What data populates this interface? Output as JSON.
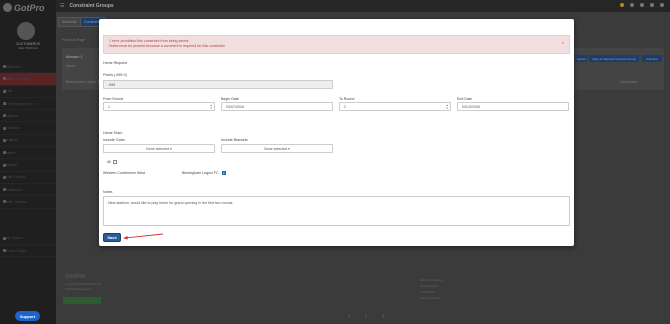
{
  "app": {
    "logo": "GotPro",
    "top_title": "Constraint Groups"
  },
  "user": {
    "name": "CUSTOMERUS",
    "link": "SEE PROFILE"
  },
  "sidebar": {
    "items": [
      {
        "label": "Dashboard"
      },
      {
        "label": "Season Manager"
      },
      {
        "label": "Clubs"
      },
      {
        "label": "Field Management"
      },
      {
        "label": "Programs"
      },
      {
        "label": "Invitations"
      },
      {
        "label": "Enrollees"
      },
      {
        "label": "Finance"
      },
      {
        "label": "Calendar"
      },
      {
        "label": "Email Reports"
      },
      {
        "label": "Checkbooks"
      },
      {
        "label": "Admin Options"
      },
      {
        "label": "Help Articles"
      },
      {
        "label": "Contact Pages"
      }
    ]
  },
  "support_label": "Support",
  "background": {
    "tab1": "Schedule",
    "tab2": "Constraints",
    "crumb": "Previous Page",
    "group_title": "Number 1",
    "col1": "Name",
    "col2": "Constraint",
    "col3": "Description",
    "row_text": "Birmingham Legion Soccer",
    "btn1": "Upload",
    "btn2": "Apply to Selected Constraint Group",
    "btn3": "Add New",
    "footer": {
      "col1": [
        "Help Center",
        "Privacy Policy"
      ],
      "col2": [
        "Copyright 2024 GotPro, Inc.",
        "All Rights Reserved"
      ],
      "col3": [
        "Terms of Service",
        "Privacy Policy",
        "Contact Us",
        "Support Center"
      ]
    },
    "pages": [
      "1",
      "2",
      "3"
    ]
  },
  "modal": {
    "alert_title": "1 error prohibited this constraint from being saved:",
    "alert_message": "Notes must be present because a comment is required for this constraint",
    "alert_close": "×",
    "points_label": "Points (-999-0)",
    "points_value": "-999",
    "home_request": "Home Request",
    "from_round_label": "From Round",
    "from_round_value": "1",
    "begin_date_label": "Begin Date",
    "begin_date_value": "03/07/2026",
    "to_round_label": "To Round",
    "to_round_value": "2",
    "end_date_label": "End Date",
    "end_date_value": "03/13/2026",
    "home_team_label": "Home Team",
    "include_clubs_label": "Include Clubs",
    "include_clubs_value": "None selected ▾",
    "include_brackets_label": "Include Brackets",
    "include_brackets_value": "None selected ▾",
    "all_label": "All",
    "conference_label": "Western Conference West",
    "team_label": "Birmingham Legion FC",
    "notes_label": "Notes",
    "notes_value": "New stadium, would like to play home for grand opening in the first two rounds.",
    "save_label": "Save"
  },
  "colors": {
    "accent": "#2b5b98",
    "error_bg": "#f2dede",
    "error_text": "#a94442",
    "annotation_arrow": "#d9302a"
  }
}
